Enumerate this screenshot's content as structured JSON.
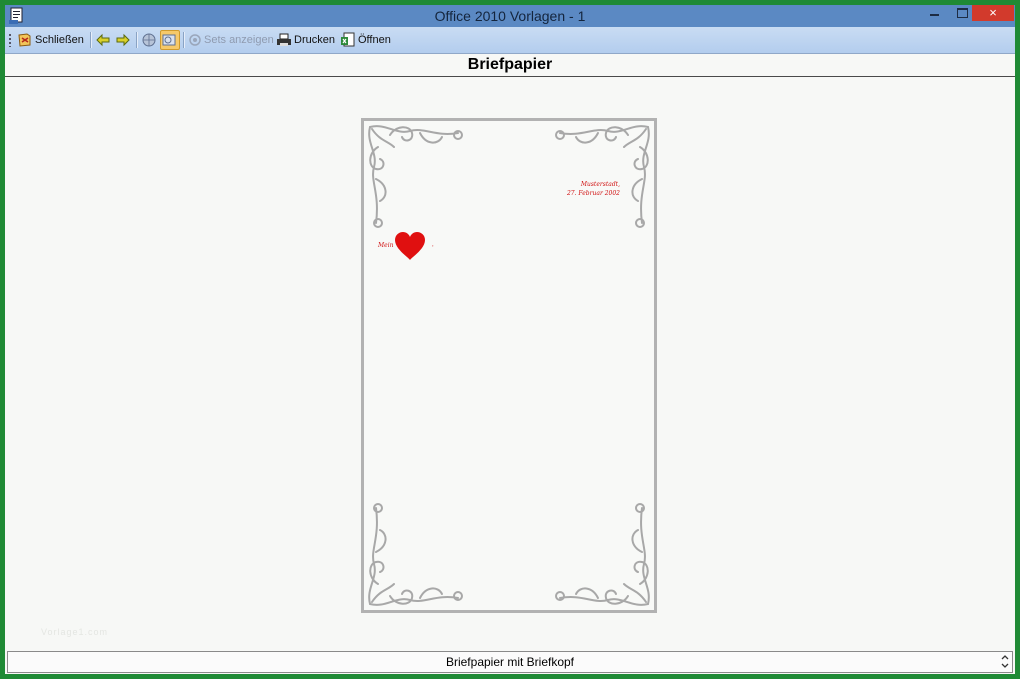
{
  "window": {
    "title": "Office 2010 Vorlagen - 1",
    "close_glyph": "×"
  },
  "toolbar": {
    "close_label": "Schließen",
    "sets_label": "Sets anzeigen",
    "print_label": "Drucken",
    "open_label": "Öffnen"
  },
  "heading": "Briefpapier",
  "letter": {
    "place": "Musterstadt,",
    "date": "27. Februar 2002",
    "salutation": "Mein",
    "salutation_end": ","
  },
  "watermark": "Vorlage1.com",
  "status": {
    "text": "Briefpapier mit Briefkopf"
  },
  "colors": {
    "accent_red": "#e01010",
    "titlebar": "#5b89c3",
    "frame": "#1f8a35"
  },
  "icons": [
    "app-icon",
    "close-doc-icon",
    "back-arrow-icon",
    "forward-arrow-icon",
    "globe-icon",
    "preview-icon",
    "sets-icon",
    "printer-icon",
    "open-file-icon",
    "heart-icon",
    "ornament-icon"
  ]
}
